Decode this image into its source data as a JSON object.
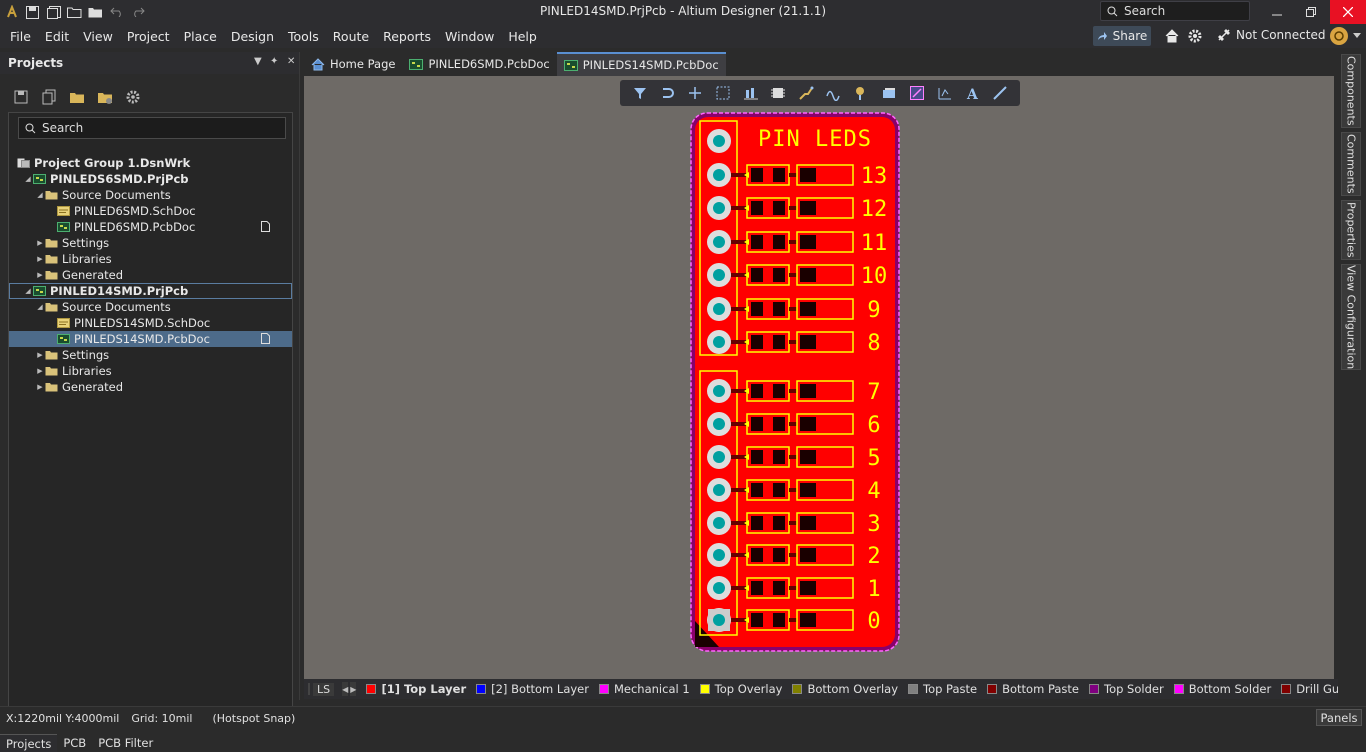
{
  "window": {
    "title": "PINLED14SMD.PrjPcb - Altium Designer (21.1.1)",
    "search_placeholder": "Search"
  },
  "menu": [
    "File",
    "Edit",
    "View",
    "Project",
    "Place",
    "Design",
    "Tools",
    "Route",
    "Reports",
    "Window",
    "Help"
  ],
  "header_right": {
    "share_label": "Share",
    "connection_status": "Not Connected"
  },
  "projects_panel": {
    "title": "Projects",
    "search_placeholder": "Search",
    "tree": [
      {
        "label": "Project Group 1.DsnWrk",
        "level": 0,
        "type": "workspace",
        "bold": true
      },
      {
        "label": "PINLEDS6SMD.PrjPcb",
        "level": 1,
        "type": "project",
        "bold": true,
        "expanded": true
      },
      {
        "label": "Source Documents",
        "level": 2,
        "type": "folder",
        "expanded": true
      },
      {
        "label": "PINLED6SMD.SchDoc",
        "level": 3,
        "type": "schdoc"
      },
      {
        "label": "PINLED6SMD.PcbDoc",
        "level": 3,
        "type": "pcbdoc",
        "badge": true
      },
      {
        "label": "Settings",
        "level": 2,
        "type": "folder"
      },
      {
        "label": "Libraries",
        "level": 2,
        "type": "folder"
      },
      {
        "label": "Generated",
        "level": 2,
        "type": "folder"
      },
      {
        "label": "PINLED14SMD.PrjPcb",
        "level": 1,
        "type": "project",
        "bold": true,
        "expanded": true,
        "outlined": true
      },
      {
        "label": "Source Documents",
        "level": 2,
        "type": "folder",
        "expanded": true
      },
      {
        "label": "PINLEDS14SMD.SchDoc",
        "level": 3,
        "type": "schdoc"
      },
      {
        "label": "PINLEDS14SMD.PcbDoc",
        "level": 3,
        "type": "pcbdoc",
        "badge": true,
        "selected": true
      },
      {
        "label": "Settings",
        "level": 2,
        "type": "folder"
      },
      {
        "label": "Libraries",
        "level": 2,
        "type": "folder"
      },
      {
        "label": "Generated",
        "level": 2,
        "type": "folder"
      }
    ],
    "bottom_tabs": [
      "Projects",
      "PCB",
      "PCB Filter"
    ]
  },
  "doc_tabs": [
    {
      "label": "Home Page",
      "icon": "home-icon"
    },
    {
      "label": "PINLED6SMD.PcbDoc",
      "icon": "pcb-doc-icon"
    },
    {
      "label": "PINLEDS14SMD.PcbDoc",
      "icon": "pcb-doc-icon",
      "active": true
    }
  ],
  "pcb": {
    "title_text": "PIN LEDS",
    "pin_labels": [
      "13",
      "12",
      "11",
      "10",
      "9",
      "8",
      "7",
      "6",
      "5",
      "4",
      "3",
      "2",
      "1",
      "0"
    ],
    "board_color": "#ff0000",
    "overlay_color": "#ffff00",
    "pad_color": "#00a0a0"
  },
  "layers": {
    "ls_label": "LS",
    "items": [
      {
        "label": "[1] Top Layer",
        "color": "#ff0000",
        "active": true
      },
      {
        "label": "[2] Bottom Layer",
        "color": "#0000ff"
      },
      {
        "label": "Mechanical 1",
        "color": "#ff00ff"
      },
      {
        "label": "Top Overlay",
        "color": "#ffff00"
      },
      {
        "label": "Bottom Overlay",
        "color": "#808000"
      },
      {
        "label": "Top Paste",
        "color": "#808080"
      },
      {
        "label": "Bottom Paste",
        "color": "#800000"
      },
      {
        "label": "Top Solder",
        "color": "#800080"
      },
      {
        "label": "Bottom Solder",
        "color": "#ff00ff"
      },
      {
        "label": "Drill Gui",
        "color": "#800000"
      }
    ]
  },
  "right_panels": [
    "Components",
    "Comments",
    "Properties",
    "View Configuration"
  ],
  "status": {
    "coords": "X:1220mil Y:4000mil",
    "grid": "Grid: 10mil",
    "snap": "(Hotspot Snap)",
    "panels_label": "Panels"
  }
}
